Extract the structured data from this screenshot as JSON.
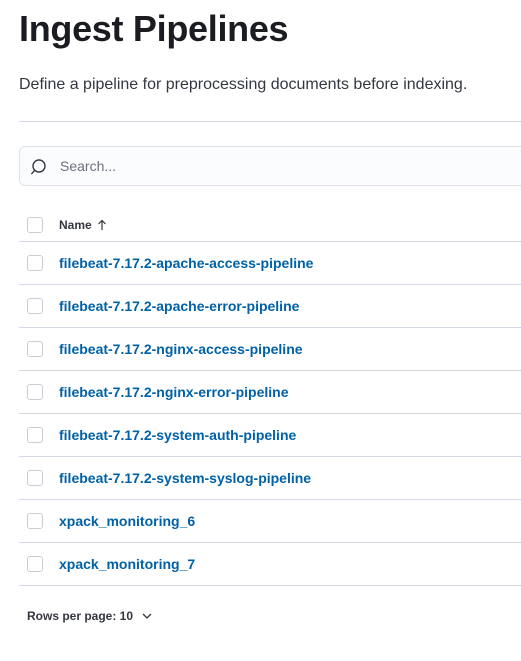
{
  "page": {
    "title": "Ingest Pipelines",
    "description": "Define a pipeline for preprocessing documents before indexing."
  },
  "search": {
    "placeholder": "Search...",
    "value": "",
    "icon": "search-icon"
  },
  "table": {
    "columns": [
      {
        "label": "Name",
        "sort": "ascending",
        "sort_icon": "sort-ascending-icon"
      }
    ],
    "rows": [
      {
        "name": "filebeat-7.17.2-apache-access-pipeline",
        "checked": false
      },
      {
        "name": "filebeat-7.17.2-apache-error-pipeline",
        "checked": false
      },
      {
        "name": "filebeat-7.17.2-nginx-access-pipeline",
        "checked": false
      },
      {
        "name": "filebeat-7.17.2-nginx-error-pipeline",
        "checked": false
      },
      {
        "name": "filebeat-7.17.2-system-auth-pipeline",
        "checked": false
      },
      {
        "name": "filebeat-7.17.2-system-syslog-pipeline",
        "checked": false
      },
      {
        "name": "xpack_monitoring_6",
        "checked": false
      },
      {
        "name": "xpack_monitoring_7",
        "checked": false
      }
    ]
  },
  "pagination": {
    "rows_per_page_label": "Rows per page: 10",
    "icon": "chevron-down-icon"
  },
  "colors": {
    "link": "#0061a6",
    "text": "#1a1c21",
    "border": "#d3dae6"
  }
}
